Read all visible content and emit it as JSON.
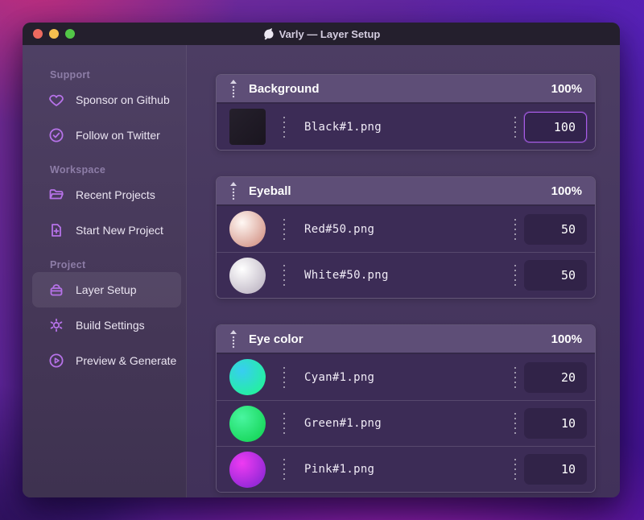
{
  "window": {
    "title": "Varly — Layer Setup",
    "traffic_lights": [
      "#ed6a5f",
      "#f5bf4f",
      "#52c647"
    ]
  },
  "accent": "#a85ce8",
  "sidebar": {
    "sections": [
      {
        "label": "Support",
        "items": [
          {
            "label": "Sponsor on Github",
            "icon": "heart"
          },
          {
            "label": "Follow on Twitter",
            "icon": "check-badge"
          }
        ]
      },
      {
        "label": "Workspace",
        "items": [
          {
            "label": "Recent Projects",
            "icon": "folder"
          },
          {
            "label": "Start New Project",
            "icon": "file-plus"
          }
        ]
      },
      {
        "label": "Project",
        "items": [
          {
            "label": "Layer Setup",
            "icon": "layers",
            "active": true
          },
          {
            "label": "Build Settings",
            "icon": "gear"
          },
          {
            "label": "Preview & Generate",
            "icon": "play-circle"
          }
        ]
      }
    ]
  },
  "main": {
    "groups": [
      {
        "title": "Background",
        "percent": "100%",
        "rows": [
          {
            "filename": "Black#1.png",
            "value": "100",
            "focused": true,
            "thumb": {
              "type": "square",
              "colors": [
                "#25202c",
                "#1a151f"
              ]
            }
          }
        ]
      },
      {
        "title": "Eyeball",
        "percent": "100%",
        "rows": [
          {
            "filename": "Red#50.png",
            "value": "50",
            "thumb": {
              "type": "sphere",
              "colors": [
                "#fff8f4",
                "#d9a195"
              ]
            }
          },
          {
            "filename": "White#50.png",
            "value": "50",
            "thumb": {
              "type": "sphere",
              "colors": [
                "#ffffff",
                "#c6bfcb"
              ]
            }
          }
        ]
      },
      {
        "title": "Eye color",
        "percent": "100%",
        "rows": [
          {
            "filename": "Cyan#1.png",
            "value": "20",
            "thumb": {
              "type": "sphere",
              "colors": [
                "#38cdf2",
                "#25efa2"
              ]
            }
          },
          {
            "filename": "Green#1.png",
            "value": "10",
            "thumb": {
              "type": "sphere",
              "colors": [
                "#49f5a0",
                "#1bd95f"
              ]
            }
          },
          {
            "filename": "Pink#1.png",
            "value": "10",
            "thumb": {
              "type": "sphere",
              "colors": [
                "#ee3bf2",
                "#9729d8"
              ]
            }
          }
        ]
      }
    ]
  }
}
